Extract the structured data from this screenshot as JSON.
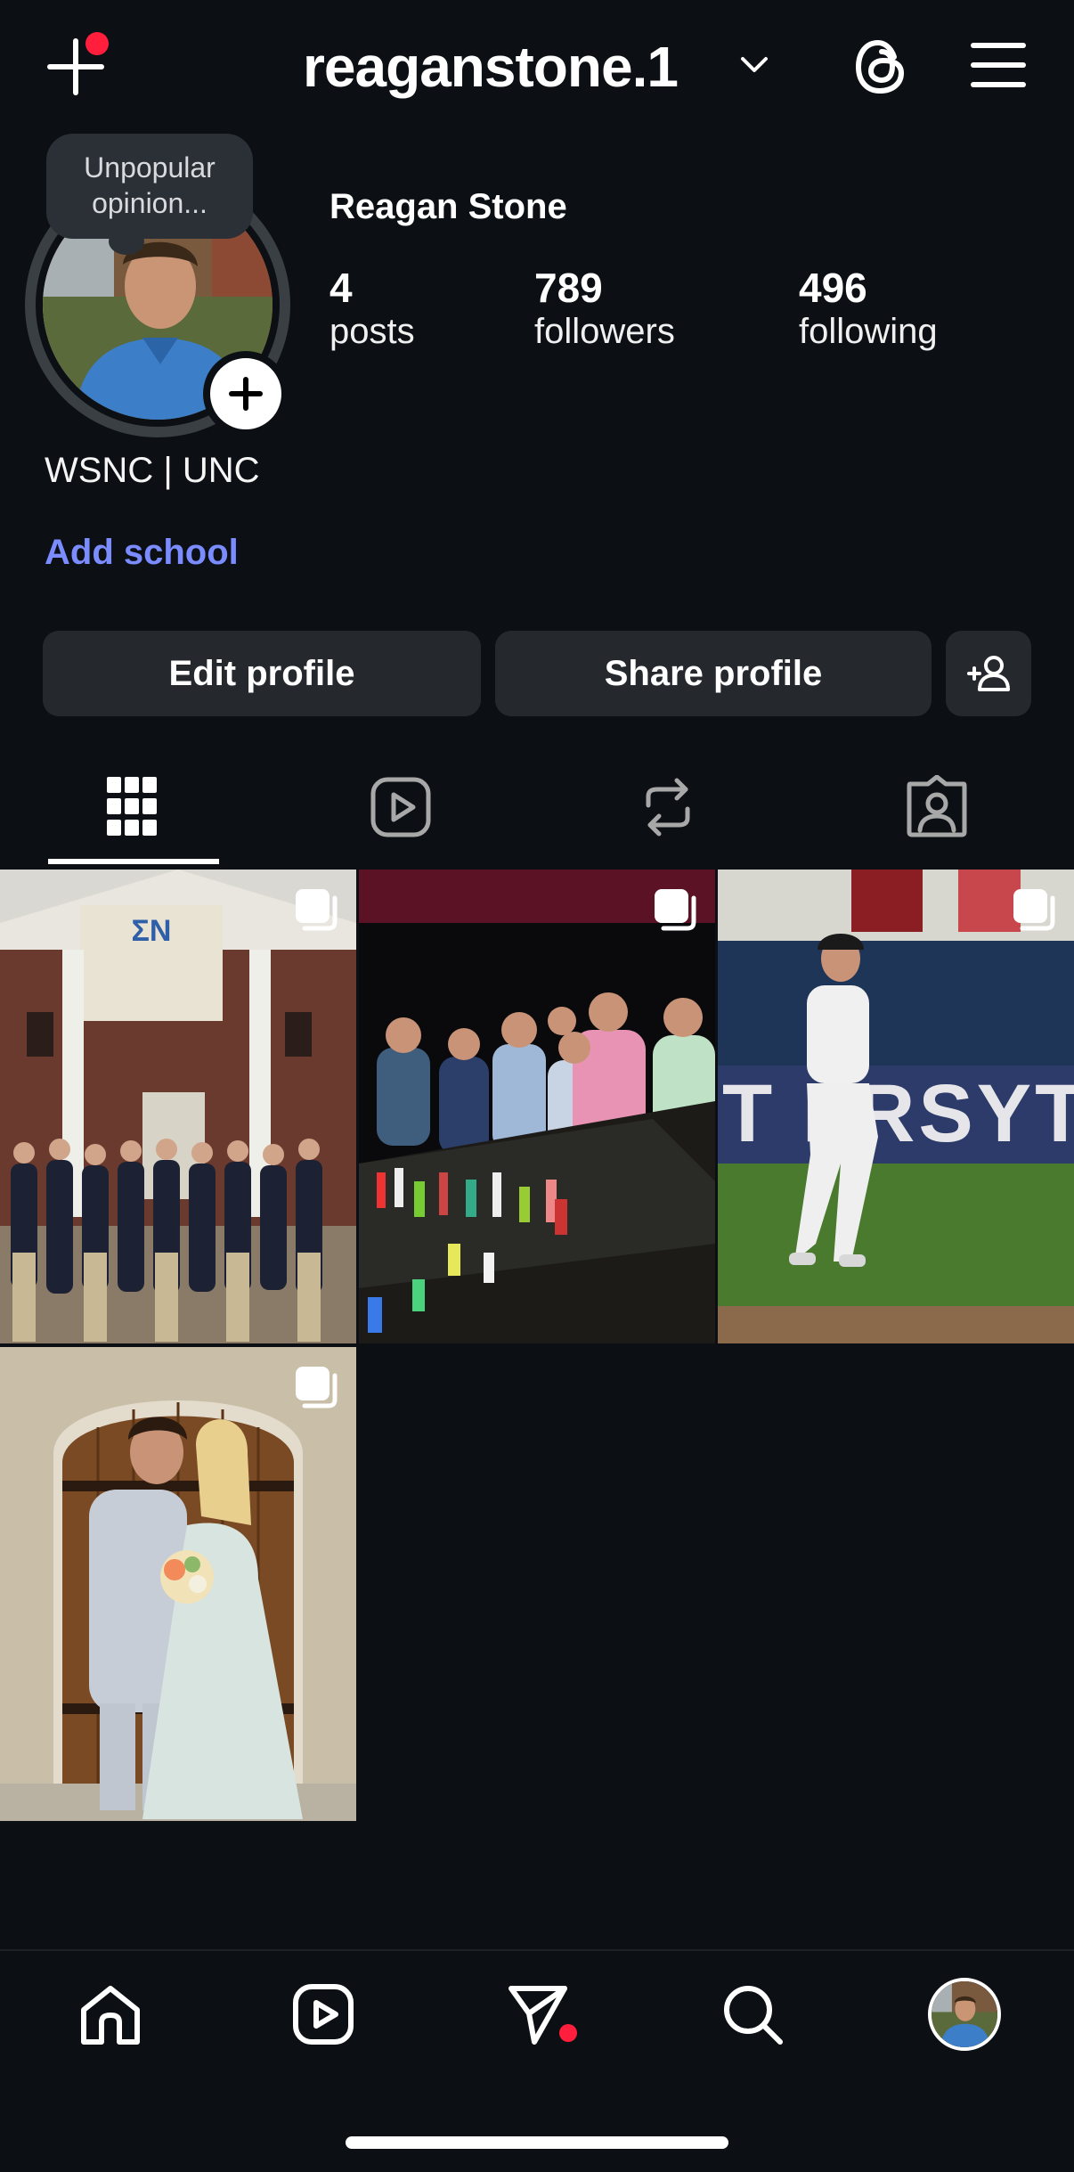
{
  "header": {
    "username": "reaganstone.1",
    "icons": [
      "plus-icon",
      "chevron-down-icon",
      "threads-icon",
      "menu-icon"
    ]
  },
  "profile": {
    "note": "Unpopular opinion...",
    "full_name": "Reagan Stone",
    "stats": [
      {
        "count": "4",
        "label": "posts"
      },
      {
        "count": "789",
        "label": "followers"
      },
      {
        "count": "496",
        "label": "following"
      }
    ],
    "bio": "WSNC | UNC",
    "add_school": "Add school"
  },
  "actions": {
    "edit_profile": "Edit profile",
    "share_profile": "Share profile"
  },
  "tabs": [
    "grid-icon",
    "reels-icon",
    "reposts-icon",
    "tagged-icon"
  ],
  "posts": [
    {
      "name": "post-fraternity-house",
      "multiple": true
    },
    {
      "name": "post-group-at-table",
      "multiple": true
    },
    {
      "name": "post-baseball-player",
      "multiple": true
    },
    {
      "name": "post-prom-couple",
      "multiple": true
    }
  ],
  "bottom_nav": [
    "home-icon",
    "reels-icon",
    "messages-icon",
    "search-icon",
    "profile-avatar"
  ],
  "colors": {
    "background": "#0c1014",
    "button": "#25292e",
    "link": "#7a8cff",
    "notification": "#ff1f3d"
  }
}
